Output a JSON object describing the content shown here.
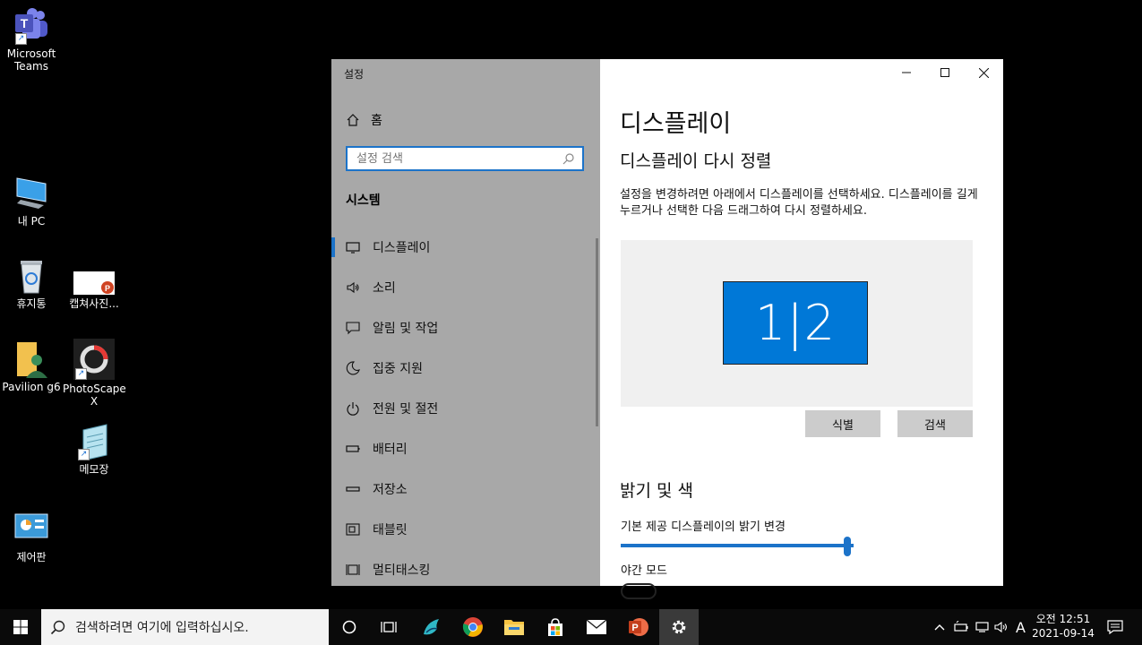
{
  "desktop": {
    "icons": [
      {
        "label": "Microsoft\nTeams",
        "icon": "teams-icon"
      },
      {
        "label": "내 PC",
        "icon": "computer-icon"
      },
      {
        "label": "휴지통",
        "icon": "recycle-bin-icon"
      },
      {
        "label": "캡쳐사진...",
        "icon": "powerpoint-file-icon"
      },
      {
        "label": "Pavilion g6",
        "icon": "user-folder-icon"
      },
      {
        "label": "PhotoScape\nX",
        "icon": "photoscape-icon"
      },
      {
        "label": "메모장",
        "icon": "notepad-icon"
      },
      {
        "label": "제어판",
        "icon": "control-panel-icon"
      }
    ]
  },
  "settings": {
    "window_title": "설정",
    "home_label": "홈",
    "search_placeholder": "설정 검색",
    "section_header": "시스템",
    "nav": [
      {
        "label": "디스플레이",
        "icon": "monitor-icon",
        "active": true
      },
      {
        "label": "소리",
        "icon": "speaker-icon"
      },
      {
        "label": "알림 및 작업",
        "icon": "notification-icon"
      },
      {
        "label": "집중 지원",
        "icon": "moon-icon"
      },
      {
        "label": "전원 및 절전",
        "icon": "power-icon"
      },
      {
        "label": "배터리",
        "icon": "battery-icon"
      },
      {
        "label": "저장소",
        "icon": "storage-icon"
      },
      {
        "label": "태블릿",
        "icon": "tablet-icon"
      },
      {
        "label": "멀티태스킹",
        "icon": "multitasking-icon"
      }
    ],
    "content": {
      "page_title": "디스플레이",
      "rearrange_heading": "디스플레이 다시 정렬",
      "rearrange_desc": "설정을 변경하려면 아래에서 디스플레이를 선택하세요. 디스플레이를 길게 누르거나 선택한 다음 드래그하여 다시 정렬하세요.",
      "monitor_label": "1|2",
      "identify_button": "식별",
      "detect_button": "검색",
      "brightness_heading": "밝기 및 색",
      "brightness_label": "기본 제공 디스플레이의 밝기 변경",
      "brightness_value": 0.99,
      "night_mode_label": "야간 모드"
    },
    "accent_color": "#1c73c9"
  },
  "taskbar": {
    "search_placeholder": "검색하려면 여기에 입력하십시오.",
    "time": "오전 12:51",
    "date": "2021-09-14",
    "ime_indicator": "A"
  }
}
